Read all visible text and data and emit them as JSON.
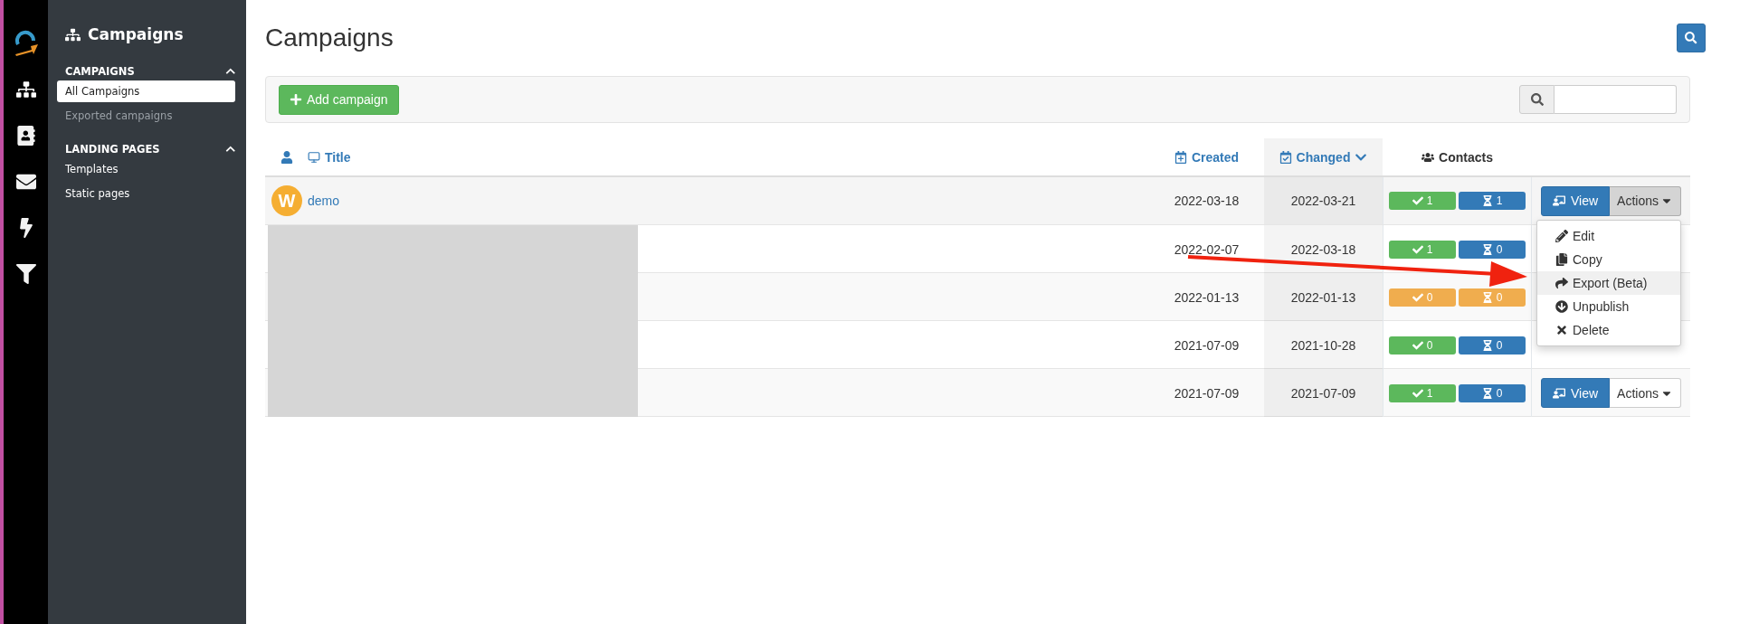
{
  "rail": {
    "items": [
      {
        "selected": false
      },
      {
        "selected": true
      },
      {
        "selected": false
      },
      {
        "selected": false
      },
      {
        "selected": false
      },
      {
        "selected": false
      }
    ]
  },
  "sidebar": {
    "title": "Campaigns",
    "sections": [
      {
        "heading": "CAMPAIGNS",
        "expanded": true,
        "items": [
          {
            "label": "All Campaigns",
            "selected": true,
            "disabled": false
          },
          {
            "label": "Exported campaigns",
            "selected": false,
            "disabled": true
          }
        ]
      },
      {
        "heading": "LANDING PAGES",
        "expanded": true,
        "items": [
          {
            "label": "Templates",
            "selected": false,
            "disabled": false
          },
          {
            "label": "Static pages",
            "selected": false,
            "disabled": false
          }
        ]
      }
    ]
  },
  "page": {
    "title": "Campaigns"
  },
  "toolbar": {
    "add_button": "Add campaign",
    "search": {
      "kind": "text"
    }
  },
  "table": {
    "columns": [
      {
        "label": "Title",
        "sorted": false
      },
      {
        "label": "Created",
        "sorted": false
      },
      {
        "label": "Changed",
        "sorted": true
      },
      {
        "label": "Contacts",
        "sorted": false
      }
    ],
    "rows": [
      {
        "avatar": "W",
        "title": "demo",
        "redacted": false,
        "created": "2022-03-18",
        "changed": "2022-03-21",
        "badges": [
          {
            "text": "1",
            "color": "#5cb85c"
          },
          {
            "text": "1",
            "color": "#337ab7"
          }
        ],
        "actions": {
          "view": "View",
          "menu": "Actions",
          "open": true
        }
      },
      {
        "redacted": true,
        "created": "2022-02-07",
        "changed": "2022-03-18",
        "badges": [
          {
            "text": "1",
            "color": "#5cb85c"
          },
          {
            "text": "0",
            "color": "#337ab7"
          }
        ]
      },
      {
        "redacted": true,
        "created": "2022-01-13",
        "changed": "2022-01-13",
        "badges": [
          {
            "text": "0",
            "color": "#f0ad4e"
          },
          {
            "text": "0",
            "color": "#f0ad4e"
          }
        ]
      },
      {
        "redacted": true,
        "created": "2021-07-09",
        "changed": "2021-10-28",
        "badges": [
          {
            "text": "0",
            "color": "#5cb85c"
          },
          {
            "text": "0",
            "color": "#337ab7"
          }
        ]
      },
      {
        "redacted": true,
        "created": "2021-07-09",
        "changed": "2021-07-09",
        "badges": [
          {
            "text": "1",
            "color": "#5cb85c"
          },
          {
            "text": "0",
            "color": "#337ab7"
          }
        ],
        "actions": {
          "view": "View",
          "menu": "Actions",
          "open": false
        }
      }
    ]
  },
  "actions_menu": {
    "items": [
      {
        "label": "Edit",
        "selected": false
      },
      {
        "label": "Copy",
        "selected": false
      },
      {
        "label": "Export (Beta)",
        "selected": true
      },
      {
        "label": "Unpublish",
        "selected": false
      },
      {
        "label": "Delete",
        "selected": false
      }
    ]
  },
  "annotation": {
    "kind": "arrow"
  }
}
